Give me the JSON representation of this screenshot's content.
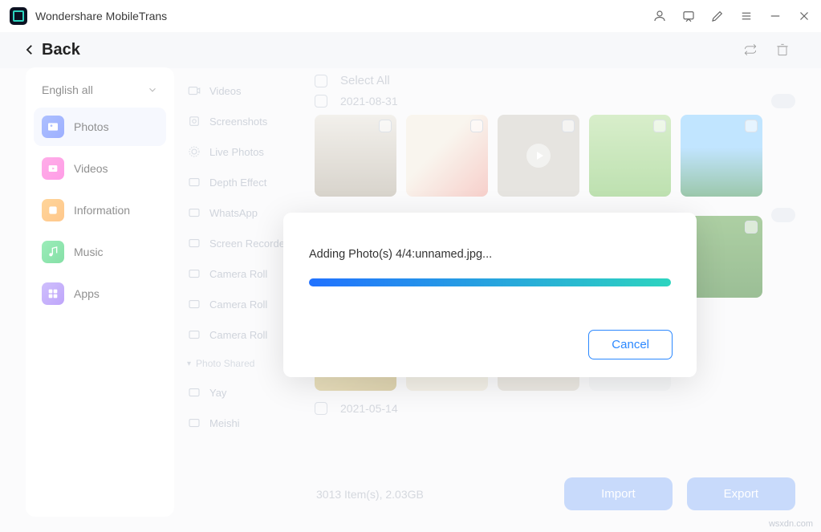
{
  "titlebar": {
    "title": "Wondershare MobileTrans"
  },
  "back": {
    "label": "Back"
  },
  "language": {
    "label": "English all"
  },
  "categories": [
    {
      "id": "photos",
      "label": "Photos",
      "active": true
    },
    {
      "id": "videos",
      "label": "Videos",
      "active": false
    },
    {
      "id": "information",
      "label": "Information",
      "active": false
    },
    {
      "id": "music",
      "label": "Music",
      "active": false
    },
    {
      "id": "apps",
      "label": "Apps",
      "active": false
    }
  ],
  "sub_items": [
    "Videos",
    "Screenshots",
    "Live Photos",
    "Depth Effect",
    "WhatsApp",
    "Screen Recorder",
    "Camera Roll",
    "Camera Roll",
    "Camera Roll"
  ],
  "sub_section": {
    "label": "Photo Shared"
  },
  "sub_items2": [
    "Yay",
    "Meishi"
  ],
  "content": {
    "select_all": "Select All",
    "date1": "2021-08-31",
    "date2": "2021-05-14",
    "summary": "3013 Item(s), 2.03GB",
    "import": "Import",
    "export": "Export"
  },
  "modal": {
    "message": "Adding Photo(s) 4/4:unnamed.jpg...",
    "cancel": "Cancel",
    "progress_percent": 100
  },
  "watermark": "wsxdn.com"
}
